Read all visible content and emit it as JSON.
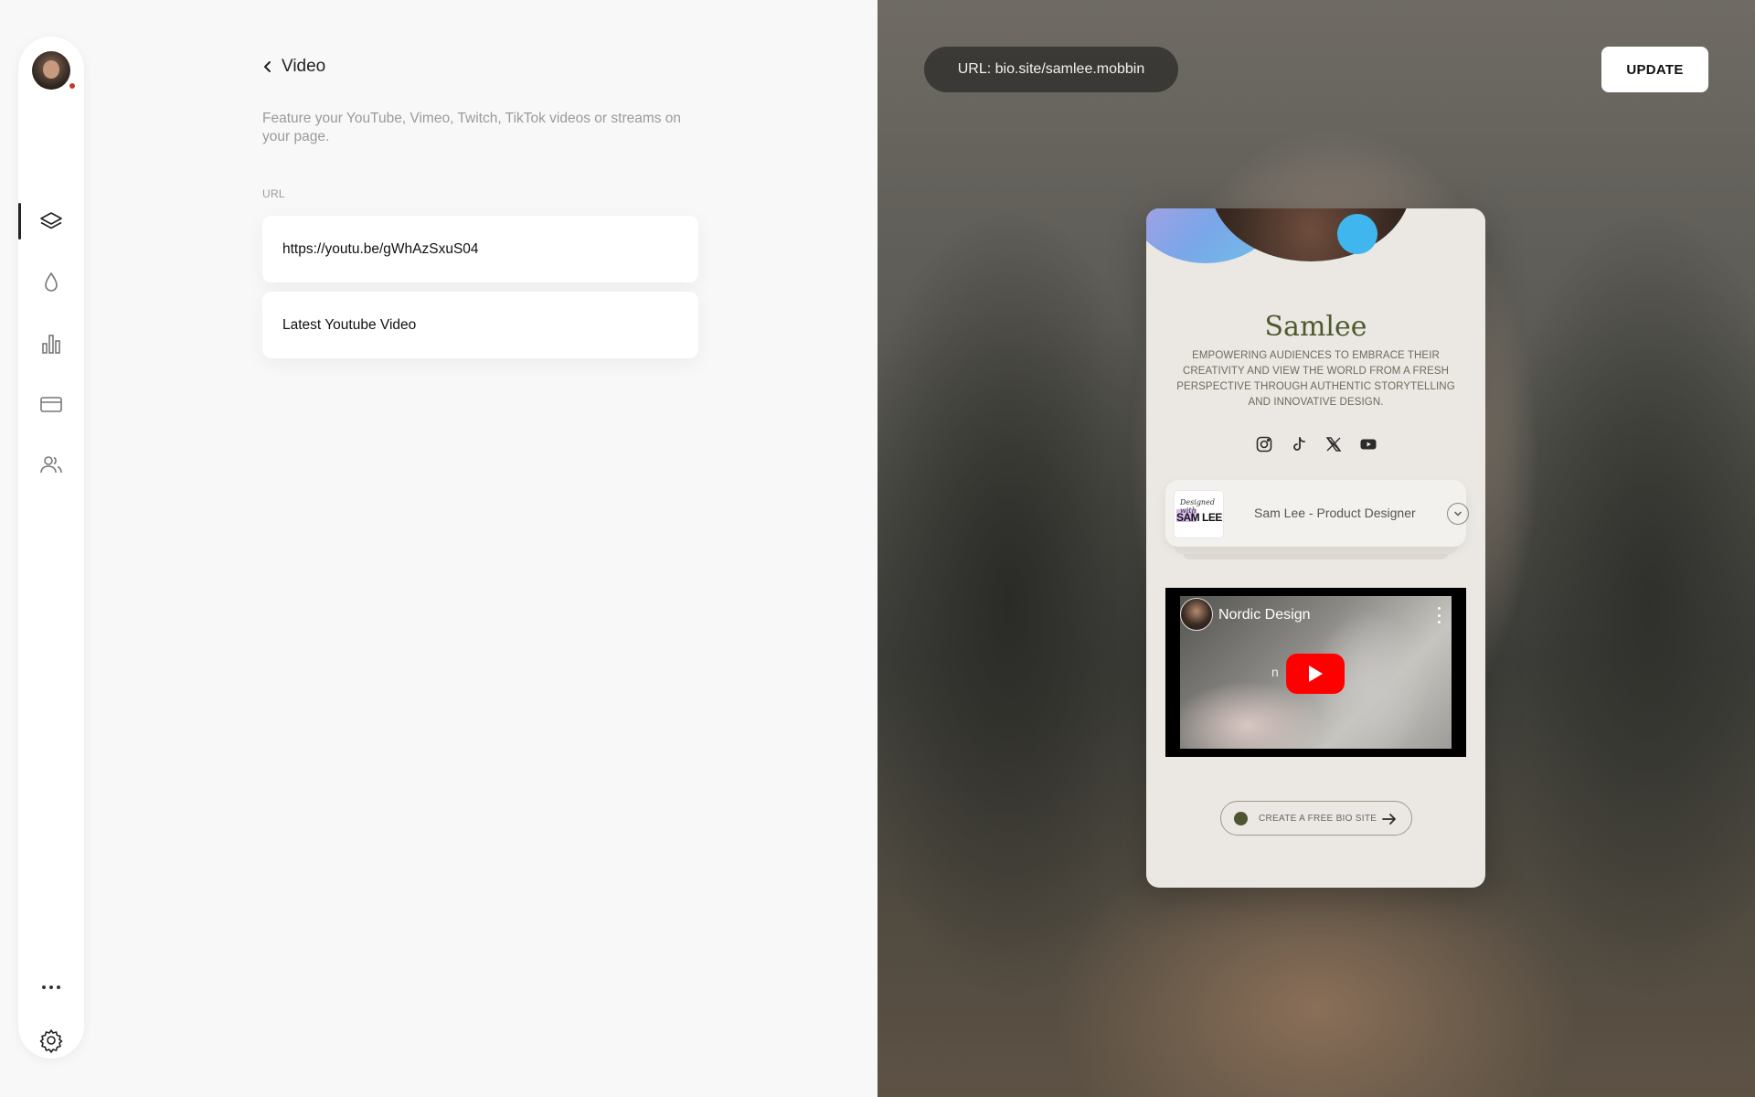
{
  "sidebar": {
    "items": [
      {
        "name": "layers-icon",
        "active": true
      },
      {
        "name": "droplet-icon",
        "active": false
      },
      {
        "name": "bar-chart-icon",
        "active": false
      },
      {
        "name": "credit-card-icon",
        "active": false
      },
      {
        "name": "users-icon",
        "active": false
      }
    ],
    "more": "more-icon",
    "settings": "gear-icon"
  },
  "editor": {
    "back_label": "Video",
    "description": "Feature your YouTube, Vimeo, Twitch, TikTok videos or streams on your page.",
    "url_label": "URL",
    "url_value": "https://youtu.be/gWhAzSxuS04",
    "title_value": "Latest Youtube Video"
  },
  "topbar": {
    "url_pill": "URL: bio.site/samlee.mobbin",
    "update_label": "UPDATE"
  },
  "preview": {
    "name": "Samlee",
    "bio": "Empowering audiences to embrace their creativity and view the world from a fresh perspective through authentic storytelling and innovative design.",
    "socials": [
      "instagram-icon",
      "tiktok-icon",
      "x-icon",
      "youtube-icon"
    ],
    "link_card": {
      "title": "Sam Lee - Product Designer",
      "thumb_script": "Designed with",
      "thumb_name": "SAM LEE"
    },
    "video": {
      "channel_title": "Nordic Design",
      "watermark": "n o          m"
    },
    "cta_label": "CREATE A FREE BIO SITE"
  },
  "colors": {
    "brand_olive": "#4e5a2e",
    "youtube_red": "#ff0000",
    "phone_bg": "#ebe8e3"
  }
}
